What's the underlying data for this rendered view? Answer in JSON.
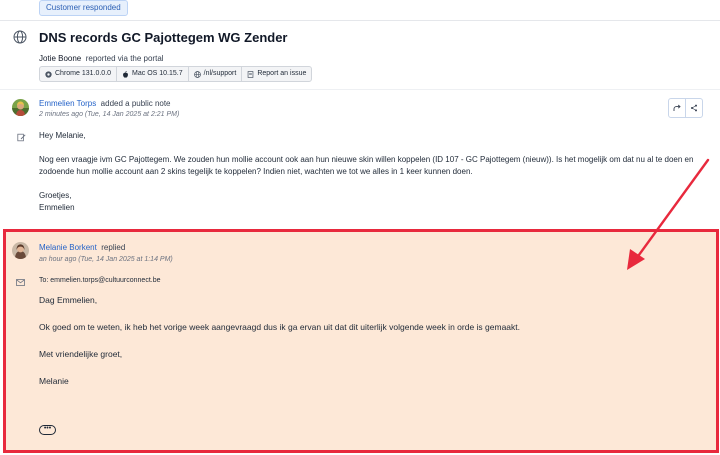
{
  "status_badge": "Customer responded",
  "ticket": {
    "title": "DNS records GC Pajottegem WG Zender",
    "reporter_name": "Jotie Boone",
    "reporter_suffix": "reported via the portal",
    "chips": [
      {
        "icon": "chrome-icon",
        "label": "Chrome 131.0.0.0"
      },
      {
        "icon": "apple-icon",
        "label": "Mac OS 10.15.7"
      },
      {
        "icon": "globe-icon",
        "label": "/nl/support"
      },
      {
        "icon": "report-icon",
        "label": "Report an issue"
      }
    ]
  },
  "note": {
    "author": "Emmelien Torps",
    "action": "added a public note",
    "time": "2 minutes ago (Tue, 14 Jan 2025 at 2:21 PM)",
    "greeting": "Hey Melanie,",
    "paragraph": "Nog een vraagje ivm GC Pajottegem. We zouden hun mollie account ook aan hun nieuwe skin willen koppelen (ID 107 - GC Pajottegem (nieuw)). Is het mogelijk om dat nu al te doen en zodoende hun mollie account aan 2 skins tegelijk te koppelen? Indien niet, wachten we tot we alles in 1 keer kunnen doen.",
    "closing_1": "Groetjes,",
    "closing_2": "Emmelien"
  },
  "reply": {
    "author": "Melanie Borkent",
    "action": "replied",
    "time": "an hour ago (Tue, 14 Jan 2025 at 1:14 PM)",
    "to": "To: emmelien.torps@cultuurconnect.be",
    "greeting": "Dag Emmelien,",
    "paragraph": "Ok goed om te weten, ik heb het vorige week aangevraagd dus ik ga ervan uit dat dit uiterlijk volgende week in orde is gemaakt.",
    "closing": "Met vriendelijke groet,",
    "signature": "Melanie",
    "more": "•••"
  },
  "colors": {
    "highlight_border": "#e8293d",
    "highlight_fill": "#fde8d7",
    "link": "#2563c8"
  }
}
